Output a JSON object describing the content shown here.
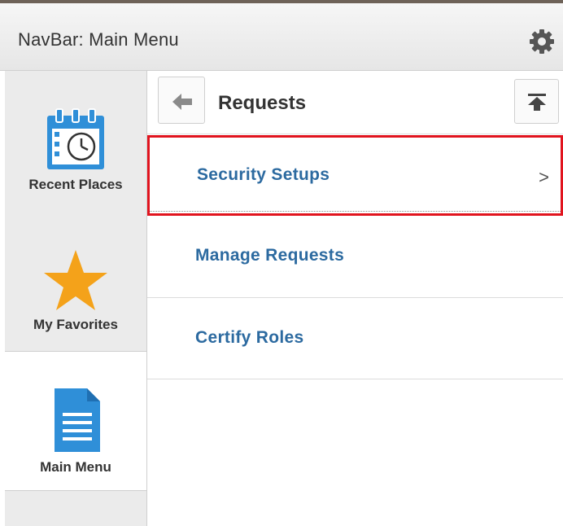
{
  "header": {
    "title": "NavBar: Main Menu",
    "settings_icon": "gear-icon"
  },
  "sidebar": {
    "items": [
      {
        "label": "Recent Places",
        "icon": "calendar-clock-icon",
        "active": false
      },
      {
        "label": "My Favorites",
        "icon": "star-icon",
        "active": false
      },
      {
        "label": "Main Menu",
        "icon": "document-icon",
        "active": true
      }
    ]
  },
  "content": {
    "title": "Requests",
    "back_icon": "back-arrow-icon",
    "top_icon": "scroll-to-top-icon",
    "rows": [
      {
        "label": "Security Setups",
        "has_chevron": true,
        "chevron": ">",
        "highlighted": true
      },
      {
        "label": "Manage Requests",
        "has_chevron": false,
        "highlighted": false
      },
      {
        "label": "Certify Roles",
        "has_chevron": false,
        "highlighted": false
      }
    ]
  },
  "colors": {
    "link_blue": "#2c6aa0",
    "highlight_red": "#e1141e",
    "icon_blue": "#2f8fd8",
    "star_orange": "#f4a21a"
  }
}
